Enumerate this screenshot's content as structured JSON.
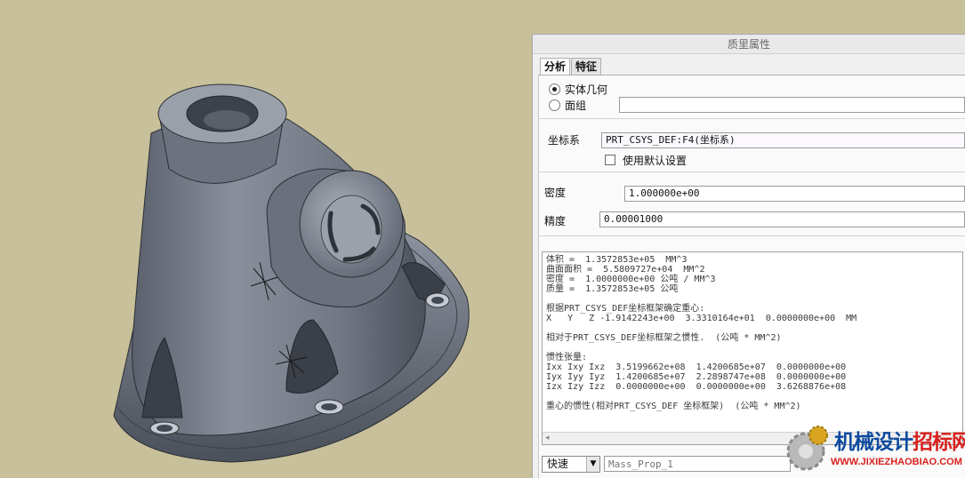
{
  "dialog": {
    "title": "质里属性",
    "tabs": [
      {
        "label": "分析",
        "active": true
      },
      {
        "label": "特征",
        "active": false
      }
    ],
    "geometry_options": [
      {
        "label": "实体几何",
        "selected": true
      },
      {
        "label": "面组",
        "selected": false
      }
    ],
    "quilt_field_value": "",
    "csys_label": "坐标系",
    "csys_value": "PRT_CSYS_DEF:F4(坐标系)",
    "use_default_label": "使用默认设置",
    "use_default_checked": false,
    "density_label": "密度",
    "density_value": "1.000000e+00",
    "accuracy_label": "精度",
    "accuracy_value": "0.00001000",
    "results": [
      "体积 =  1.3572853e+05  MM^3",
      "曲面面积 =  5.5809727e+04  MM^2",
      "密度 =  1.0000000e+00 公吨 / MM^3",
      "质量 =  1.3572853e+05 公吨",
      "",
      "根据PRT_CSYS_DEF坐标框架确定重心:",
      "X   Y   Z -1.9142243e+00  3.3310164e+01  0.0000000e+00  MM",
      "",
      "相对于PRT_CSYS_DEF坐标框架之惯性.  (公吨 * MM^2)",
      "",
      "惯性张量:",
      "Ixx Ixy Ixz  3.5199662e+08  1.4200685e+07  0.0000000e+00",
      "Iyx Iyy Iyz  1.4200685e+07  2.2898747e+08  0.0000000e+00",
      "Izx Izy Izz  0.0000000e+00  0.0000000e+00  3.6268876e+08",
      "",
      "重心的惯性(相对PRT_CSYS_DEF 坐标框架)  (公吨 * MM^2)"
    ],
    "scroll_left_glyph": "◂",
    "mode_select_value": "快速",
    "mode_select_arrow": "▼",
    "analysis_name_placeholder": "Mass_Prop_1"
  },
  "watermark": {
    "text_blue": "机械设计",
    "text_red": "招标网",
    "url": "WWW.JIXIEZHAOBIAO.COM"
  },
  "colors": {
    "background": "#c8c09a",
    "part_body": "#7e8591",
    "dialog_bg": "#f0f0f0",
    "watermark_blue": "#0d4a9e",
    "watermark_red": "#d8201e"
  },
  "icons": [
    "radio-button-icon",
    "checkbox-icon",
    "dropdown-arrow-icon",
    "gear-logo-icon"
  ]
}
